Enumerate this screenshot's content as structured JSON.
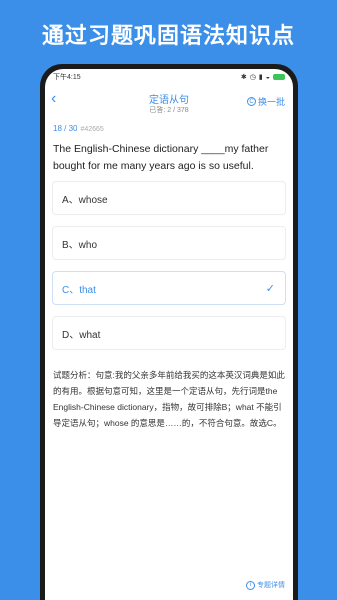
{
  "promo": {
    "headline": "通过习题巩固语法知识点"
  },
  "status_bar": {
    "time": "下午4:15",
    "icons": [
      "bluetooth-icon",
      "alarm-icon",
      "signal-icon",
      "wifi-icon",
      "battery-icon"
    ]
  },
  "nav": {
    "title": "定语从句",
    "progress": "已答: 2 / 378",
    "swap_label": "换一批"
  },
  "question": {
    "index": "18 / 30",
    "id": "#42665",
    "text": "The English-Chinese dictionary ____my father bought for me many years ago is so useful."
  },
  "options": [
    {
      "label": "A、whose",
      "selected": false
    },
    {
      "label": "B、who",
      "selected": false
    },
    {
      "label": "C、that",
      "selected": true
    },
    {
      "label": "D、what",
      "selected": false
    }
  ],
  "analysis": "试题分析：句意:我的父亲多年前给我买的这本英汉词典是如此的有用。根据句意可知，这里是一个定语从句，先行词是the English-Chinese dictionary，指物，故可排除B；what 不能引导定语从句；whose 的意思是……的，不符合句意。故选C。",
  "footer": {
    "detail_label": "专题详情"
  },
  "colors": {
    "accent": "#3b8fe8",
    "background": "#3b8fe8"
  }
}
